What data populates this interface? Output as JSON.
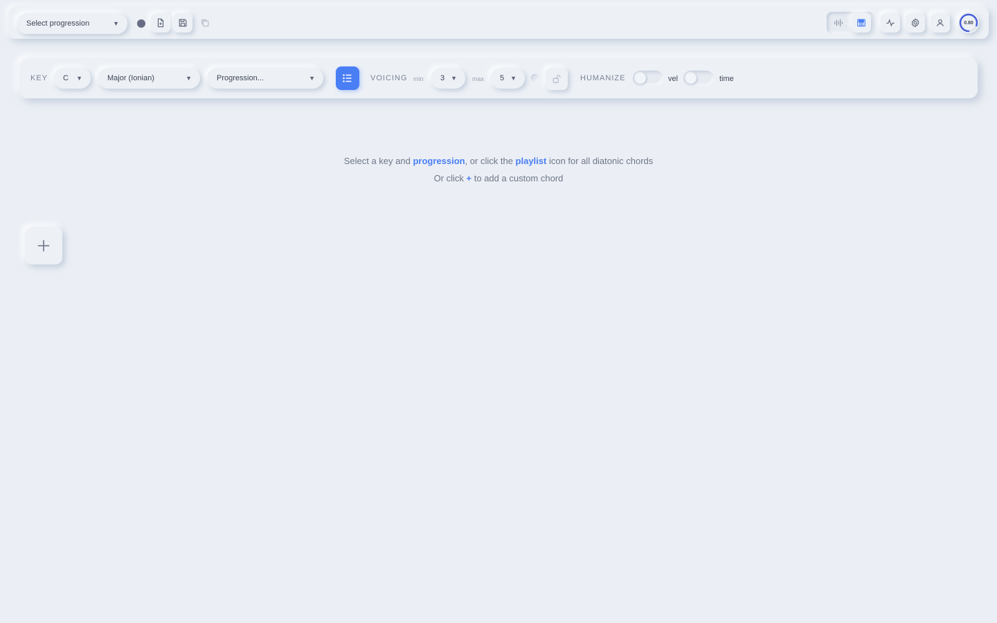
{
  "topbar": {
    "progression_select": {
      "value": "Select progression"
    },
    "gauge_value": "0.80"
  },
  "controls": {
    "key_label": "KEY",
    "key_value": "C",
    "mode_value": "Major (Ionian)",
    "progression_value": "Progression...",
    "voicing_label": "VOICING",
    "min_label": "min",
    "min_value": "3",
    "max_label": "max",
    "max_value": "5",
    "humanize_label": "HUMANIZE",
    "vel_label": "vel",
    "time_label": "time"
  },
  "empty_state": {
    "line1_part1": "Select a key and ",
    "line1_link1": "progression",
    "line1_part2": ", or click the ",
    "line1_link2": "playlist",
    "line1_part3": " icon for all diatonic chords",
    "line2_part1": "Or click ",
    "line2_plus": "+",
    "line2_part2": " to add a custom chord"
  },
  "colors": {
    "background": "#ebeff5",
    "accent": "#4a7ef5",
    "text": "#3d4355",
    "muted": "#7a8194"
  }
}
